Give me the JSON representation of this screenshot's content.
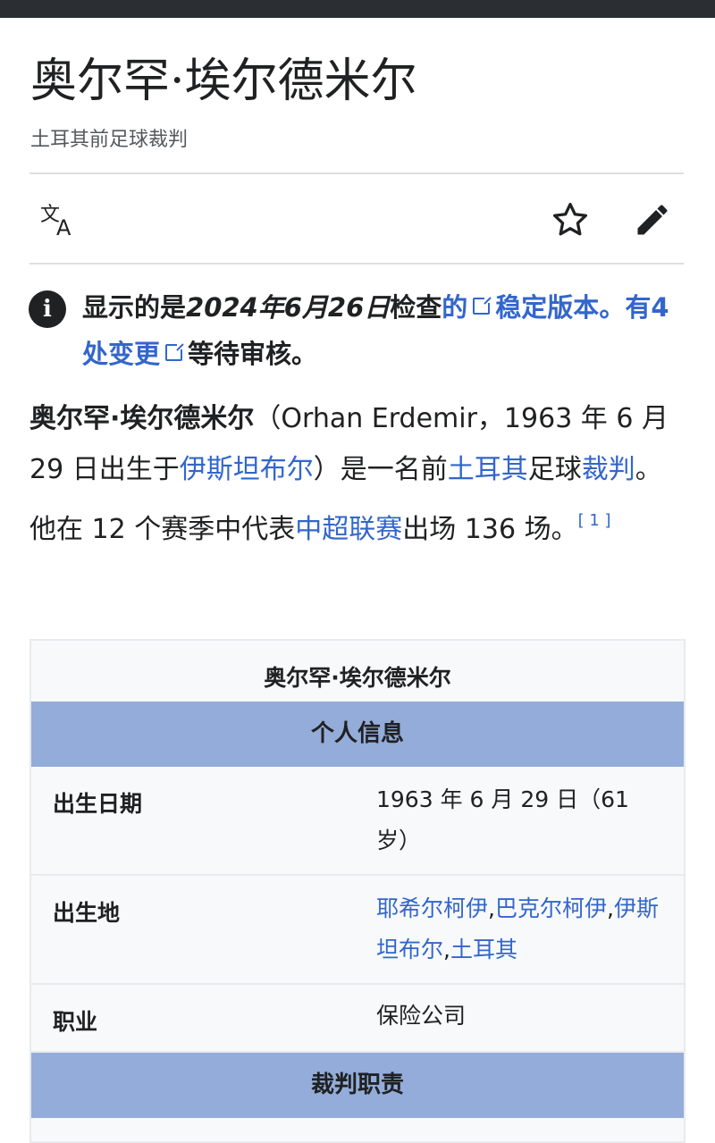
{
  "page": {
    "title": "奥尔罕·埃尔德米尔",
    "subtitle": "土耳其前足球裁判"
  },
  "toolbar": {
    "language_icon": "translate-icon",
    "watch_icon": "star-icon",
    "edit_icon": "pencil-icon"
  },
  "notice": {
    "icon": "info-icon",
    "prefix": "显示的是",
    "date": "2024年6月26日",
    "checked": "检查",
    "link1": "的",
    "link2": "稳定版本",
    "period": "。",
    "changes_link": "有4 处变更",
    "suffix": "等待审核。"
  },
  "lead": {
    "name": "奥尔罕·埃尔德米尔",
    "paren_open": "（Orhan Erdemir，1963 年 6 月 29 日出生于",
    "birthplace_link": "伊斯坦布尔",
    "t2": "）是一名前",
    "country_link": "土耳其",
    "t3": "足球",
    "referee_link": "裁判",
    "t4": "。他在 12 个赛季中代表",
    "league_link": "中超联赛",
    "t5": "出场 136 场。",
    "ref": "[ 1 ]"
  },
  "infobox": {
    "caption": "奥尔罕·埃尔德米尔",
    "section_personal": "个人信息",
    "born_label": "出生日期",
    "born_value": "1963 年 6 月 29 日（61 岁）",
    "birthplace_label": "出生地",
    "birthplace_link1": "耶希尔柯伊",
    "comma1": ",",
    "birthplace_link2": "巴克尔柯伊",
    "comma2": ",",
    "birthplace_link3": "伊斯坦布尔",
    "comma3": ",",
    "birthplace_link4": "土耳其",
    "occupation_label": "职业",
    "occupation_value": "保险公司",
    "section_referee": "裁判职责"
  },
  "colors": {
    "link": "#3366cc",
    "infobox_header": "#93acd9",
    "text": "#202122"
  }
}
